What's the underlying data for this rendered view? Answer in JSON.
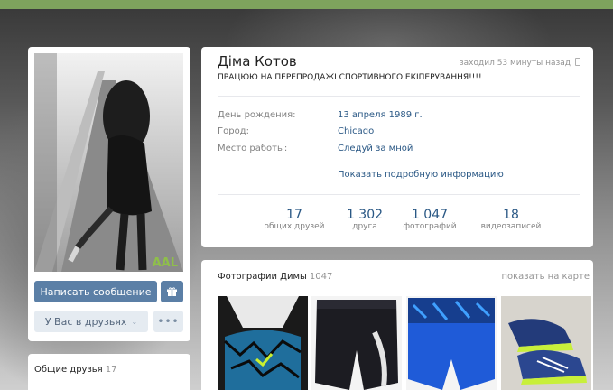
{
  "profile": {
    "name": "Діма Котов",
    "last_seen": "заходил 53 минуты назад",
    "status": "ПРАЦЮЮ НА ПЕРЕПРОДАЖІ СПОРТИВНОГО ЕКІПЕРУВАННЯ!!!!",
    "watermark": "AAL",
    "info": [
      {
        "label": "День рождения:",
        "value": "13 апреля 1989 г."
      },
      {
        "label": "Город:",
        "value": "Chicago"
      },
      {
        "label": "Место работы:",
        "value": "Следуй за мной"
      }
    ],
    "more_info": "Показать подробную информацию",
    "counters": [
      {
        "num": "17",
        "label": "общих друзей"
      },
      {
        "num": "1 302",
        "label": "друга"
      },
      {
        "num": "1 047",
        "label": "фотографий"
      },
      {
        "num": "18",
        "label": "видеозаписей"
      }
    ]
  },
  "actions": {
    "send_message": "Написать сообщение",
    "gift_icon": "gift-icon",
    "in_friends": "У Вас в друзьях",
    "more": "•••"
  },
  "common_friends": {
    "title": "Общие друзья",
    "count": "17"
  },
  "photos": {
    "title": "Фотографии Димы",
    "count": "1047",
    "map_link": "показать на карте",
    "items": [
      "sports-bra-photo",
      "black-shorts-photo",
      "blue-shorts-photo",
      "sneakers-photo"
    ]
  },
  "colors": {
    "topbar": "#7ea35d",
    "button": "#5b7fa6",
    "link": "#2a5885"
  }
}
